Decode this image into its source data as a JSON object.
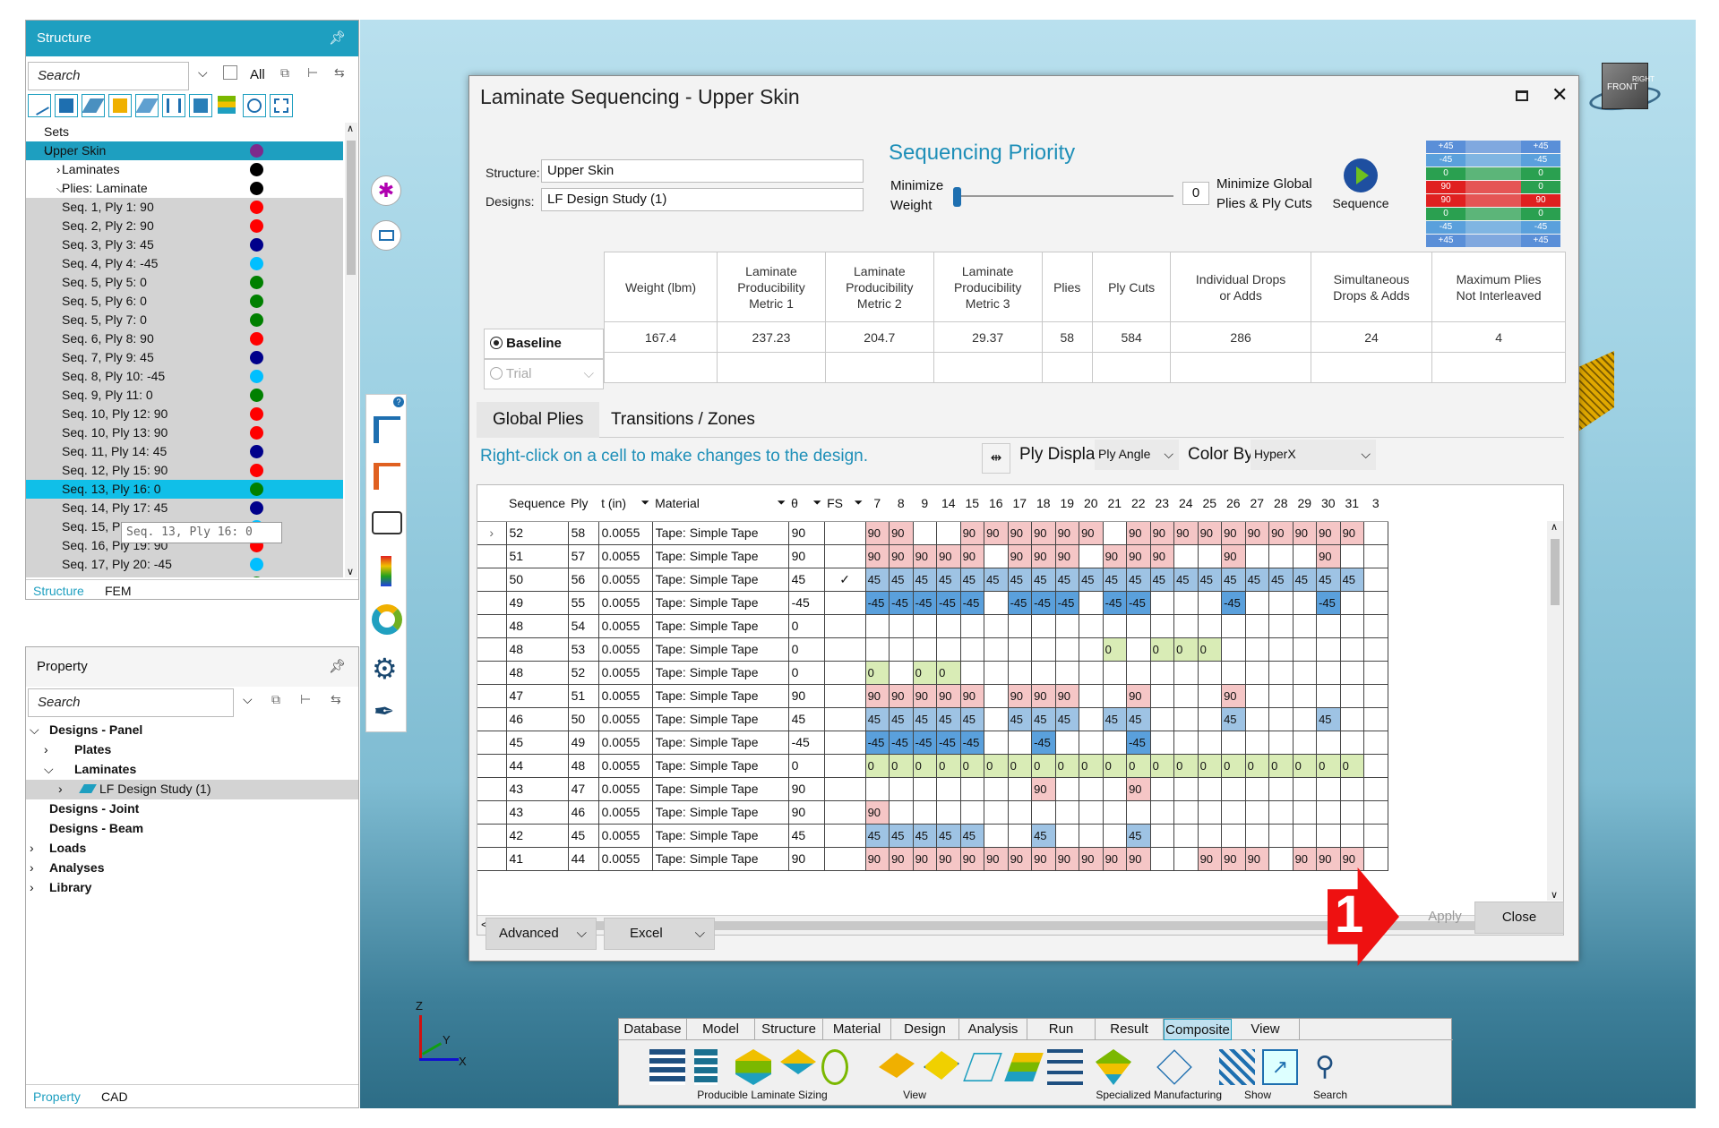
{
  "structure_panel": {
    "title": "Structure",
    "search_placeholder": "Search",
    "all_label": "All",
    "tree": [
      {
        "label": "Sets",
        "indent": 0,
        "color": ""
      },
      {
        "label": "Upper Skin",
        "indent": 1,
        "color": "#7d2a8c",
        "selected": true
      },
      {
        "label": "Laminates",
        "indent": 2,
        "color": "#000000"
      },
      {
        "label": "Plies: Laminate",
        "indent": 2,
        "color": "#000000"
      },
      {
        "label": "Seq. 1, Ply 1: 90",
        "indent": 3,
        "color": "#ff0000"
      },
      {
        "label": "Seq. 2, Ply 2: 90",
        "indent": 3,
        "color": "#ff0000"
      },
      {
        "label": "Seq. 3, Ply 3: 45",
        "indent": 3,
        "color": "#00008b"
      },
      {
        "label": "Seq. 4, Ply 4: -45",
        "indent": 3,
        "color": "#00bfff"
      },
      {
        "label": "Seq. 5, Ply 5: 0",
        "indent": 3,
        "color": "#008000"
      },
      {
        "label": "Seq. 5, Ply 6: 0",
        "indent": 3,
        "color": "#008000"
      },
      {
        "label": "Seq. 5, Ply 7: 0",
        "indent": 3,
        "color": "#008000"
      },
      {
        "label": "Seq. 6, Ply 8: 90",
        "indent": 3,
        "color": "#ff0000"
      },
      {
        "label": "Seq. 7, Ply 9: 45",
        "indent": 3,
        "color": "#00008b"
      },
      {
        "label": "Seq. 8, Ply 10: -45",
        "indent": 3,
        "color": "#00bfff"
      },
      {
        "label": "Seq. 9, Ply 11: 0",
        "indent": 3,
        "color": "#008000"
      },
      {
        "label": "Seq. 10, Ply 12: 90",
        "indent": 3,
        "color": "#ff0000"
      },
      {
        "label": "Seq. 10, Ply 13: 90",
        "indent": 3,
        "color": "#ff0000"
      },
      {
        "label": "Seq. 11, Ply 14: 45",
        "indent": 3,
        "color": "#00008b"
      },
      {
        "label": "Seq. 12, Ply 15: 90",
        "indent": 3,
        "color": "#ff0000"
      },
      {
        "label": "Seq. 13, Ply 16: 0",
        "indent": 3,
        "color": "#008000",
        "highlight": true
      },
      {
        "label": "Seq. 14, Ply 17: 45",
        "indent": 3,
        "color": "#00008b"
      },
      {
        "label": "Seq. 15, Ply 18: -45",
        "indent": 3,
        "color": "#00bfff"
      },
      {
        "label": "Seq. 16, Ply 19: 90",
        "indent": 3,
        "color": "#ff0000"
      },
      {
        "label": "Seq. 17, Ply 20: -45",
        "indent": 3,
        "color": "#00bfff"
      },
      {
        "label": "Seq. 18, Ply 21: 0",
        "indent": 3,
        "color": "#008000"
      }
    ],
    "tooltip": "Seq. 13, Ply 16: 0",
    "tabs": [
      "Structure",
      "FEM"
    ]
  },
  "property_panel": {
    "title": "Property",
    "search_placeholder": "Search",
    "tree": [
      {
        "label": "Designs - Panel",
        "indent": 0,
        "expander": "v"
      },
      {
        "label": "Plates",
        "indent": 1,
        "expander": ">"
      },
      {
        "label": "Laminates",
        "indent": 1,
        "expander": "v"
      },
      {
        "label": "LF Design Study (1)",
        "indent": 2,
        "expander": ">",
        "selected": true
      },
      {
        "label": "Designs - Joint",
        "indent": 0,
        "expander": ""
      },
      {
        "label": "Designs - Beam",
        "indent": 0,
        "expander": ""
      },
      {
        "label": "Loads",
        "indent": 0,
        "expander": ">"
      },
      {
        "label": "Analyses",
        "indent": 0,
        "expander": ">"
      },
      {
        "label": "Library",
        "indent": 0,
        "expander": ">"
      }
    ],
    "tabs": [
      "Property",
      "CAD"
    ]
  },
  "dialog": {
    "title": "Laminate Sequencing - Upper Skin",
    "structure_label": "Structure:",
    "structure_value": "Upper Skin",
    "designs_label": "Designs:",
    "designs_value": "LF Design Study (1)",
    "priority_title": "Sequencing Priority",
    "minimize_weight": [
      "Minimize",
      "Weight"
    ],
    "slider_value": "0",
    "minimize_global": [
      "Minimize Global",
      "Plies & Ply Cuts"
    ],
    "sequence_label": "Sequence",
    "preview_labels": [
      "+45",
      "-45",
      "0",
      "90",
      "90",
      "0",
      "-45",
      "+45"
    ],
    "preview_labels_right": [
      "+45",
      "-45",
      "0",
      "0",
      "90",
      "0",
      "-45",
      "+45"
    ],
    "metrics_headers": [
      [
        "Weight (lbm)"
      ],
      [
        "Laminate",
        "Producibility",
        "Metric 1"
      ],
      [
        "Laminate",
        "Producibility",
        "Metric 2"
      ],
      [
        "Laminate",
        "Producibility",
        "Metric 3"
      ],
      [
        "Plies"
      ],
      [
        "Ply Cuts"
      ],
      [
        "Individual Drops",
        "or Adds"
      ],
      [
        "Simultaneous",
        "Drops & Adds"
      ],
      [
        "Maximum Plies",
        "Not Interleaved"
      ]
    ],
    "baseline_label": "Baseline",
    "baseline_values": [
      "167.4",
      "237.23",
      "204.7",
      "29.37",
      "58",
      "584",
      "286",
      "24",
      "4"
    ],
    "trial_label": "Trial",
    "tabs": [
      "Global Plies",
      "Transitions / Zones"
    ],
    "hint": "Right-click on a cell to make changes to the design.",
    "ply_display_label": "Ply Display",
    "ply_display_value": "Ply Angle",
    "color_by_label": "Color By",
    "color_by_value": "HyperX",
    "grid_headers": [
      "Sequence",
      "Ply",
      "t (in)",
      "Material",
      "θ",
      "FS"
    ],
    "zone_headers": [
      "7",
      "8",
      "9",
      "14",
      "15",
      "16",
      "17",
      "18",
      "19",
      "20",
      "21",
      "22",
      "23",
      "24",
      "25",
      "26",
      "27",
      "28",
      "29",
      "30",
      "31",
      "3"
    ],
    "rows": [
      {
        "seq": "52",
        "ply": "58",
        "t": "0.0055",
        "mat": "Tape: Simple Tape",
        "th": "90",
        "fs": "",
        "cells": [
          "90",
          "90",
          "",
          "",
          "90",
          "90",
          "90",
          "90",
          "90",
          "90",
          "",
          "90",
          "90",
          "90",
          "90",
          "90",
          "90",
          "90",
          "90",
          "90",
          "90",
          ""
        ]
      },
      {
        "seq": "51",
        "ply": "57",
        "t": "0.0055",
        "mat": "Tape: Simple Tape",
        "th": "90",
        "fs": "",
        "cells": [
          "90",
          "90",
          "90",
          "90",
          "90",
          "",
          "90",
          "90",
          "90",
          "",
          "90",
          "90",
          "90",
          "",
          "",
          "90",
          "",
          "",
          "",
          "90",
          "",
          ""
        ]
      },
      {
        "seq": "50",
        "ply": "56",
        "t": "0.0055",
        "mat": "Tape: Simple Tape",
        "th": "45",
        "fs": "✓",
        "cells": [
          "45",
          "45",
          "45",
          "45",
          "45",
          "45",
          "45",
          "45",
          "45",
          "45",
          "45",
          "45",
          "45",
          "45",
          "45",
          "45",
          "45",
          "45",
          "45",
          "45",
          "45",
          ""
        ]
      },
      {
        "seq": "49",
        "ply": "55",
        "t": "0.0055",
        "mat": "Tape: Simple Tape",
        "th": "-45",
        "fs": "",
        "cells": [
          "-45",
          "-45",
          "-45",
          "-45",
          "-45",
          "",
          "-45",
          "-45",
          "-45",
          "",
          "-45",
          "-45",
          "",
          "",
          "",
          "-45",
          "",
          "",
          "",
          "-45",
          "",
          ""
        ]
      },
      {
        "seq": "48",
        "ply": "54",
        "t": "0.0055",
        "mat": "Tape: Simple Tape",
        "th": "0",
        "fs": "",
        "cells": [
          "",
          "",
          "",
          "",
          "",
          "",
          "",
          "",
          "",
          "",
          "",
          "",
          "",
          "",
          "",
          "",
          "",
          "",
          "",
          "",
          "",
          ""
        ]
      },
      {
        "seq": "48",
        "ply": "53",
        "t": "0.0055",
        "mat": "Tape: Simple Tape",
        "th": "0",
        "fs": "",
        "cells": [
          "",
          "",
          "",
          "",
          "",
          "",
          "",
          "",
          "",
          "",
          "0",
          "",
          "0",
          "0",
          "0",
          "",
          "",
          "",
          "",
          "",
          "",
          ""
        ]
      },
      {
        "seq": "48",
        "ply": "52",
        "t": "0.0055",
        "mat": "Tape: Simple Tape",
        "th": "0",
        "fs": "",
        "cells": [
          "0",
          "",
          "0",
          "0",
          "",
          "",
          "",
          "",
          "",
          "",
          "",
          "",
          "",
          "",
          "",
          "",
          "",
          "",
          "",
          "",
          "",
          ""
        ]
      },
      {
        "seq": "47",
        "ply": "51",
        "t": "0.0055",
        "mat": "Tape: Simple Tape",
        "th": "90",
        "fs": "",
        "cells": [
          "90",
          "90",
          "90",
          "90",
          "90",
          "",
          "90",
          "90",
          "90",
          "",
          "",
          "90",
          "",
          "",
          "",
          "90",
          "",
          "",
          "",
          "",
          "",
          ""
        ]
      },
      {
        "seq": "46",
        "ply": "50",
        "t": "0.0055",
        "mat": "Tape: Simple Tape",
        "th": "45",
        "fs": "",
        "cells": [
          "45",
          "45",
          "45",
          "45",
          "45",
          "",
          "45",
          "45",
          "45",
          "",
          "45",
          "45",
          "",
          "",
          "",
          "45",
          "",
          "",
          "",
          "45",
          "",
          ""
        ]
      },
      {
        "seq": "45",
        "ply": "49",
        "t": "0.0055",
        "mat": "Tape: Simple Tape",
        "th": "-45",
        "fs": "",
        "cells": [
          "-45",
          "-45",
          "-45",
          "-45",
          "-45",
          "",
          "",
          "-45",
          "",
          "",
          "",
          "-45",
          "",
          "",
          "",
          "",
          "",
          "",
          "",
          "",
          "",
          ""
        ]
      },
      {
        "seq": "44",
        "ply": "48",
        "t": "0.0055",
        "mat": "Tape: Simple Tape",
        "th": "0",
        "fs": "",
        "cells": [
          "0",
          "0",
          "0",
          "0",
          "0",
          "0",
          "0",
          "0",
          "0",
          "0",
          "0",
          "0",
          "0",
          "0",
          "0",
          "0",
          "0",
          "0",
          "0",
          "0",
          "0",
          ""
        ]
      },
      {
        "seq": "43",
        "ply": "47",
        "t": "0.0055",
        "mat": "Tape: Simple Tape",
        "th": "90",
        "fs": "",
        "cells": [
          "",
          "",
          "",
          "",
          "",
          "",
          "",
          "90",
          "",
          "",
          "",
          "90",
          "",
          "",
          "",
          "",
          "",
          "",
          "",
          "",
          "",
          ""
        ]
      },
      {
        "seq": "43",
        "ply": "46",
        "t": "0.0055",
        "mat": "Tape: Simple Tape",
        "th": "90",
        "fs": "",
        "cells": [
          "90",
          "",
          "",
          "",
          "",
          "",
          "",
          "",
          "",
          "",
          "",
          "",
          "",
          "",
          "",
          "",
          "",
          "",
          "",
          "",
          "",
          ""
        ]
      },
      {
        "seq": "42",
        "ply": "45",
        "t": "0.0055",
        "mat": "Tape: Simple Tape",
        "th": "45",
        "fs": "",
        "cells": [
          "45",
          "45",
          "45",
          "45",
          "45",
          "",
          "",
          "45",
          "",
          "",
          "",
          "45",
          "",
          "",
          "",
          "",
          "",
          "",
          "",
          "",
          "",
          ""
        ]
      },
      {
        "seq": "41",
        "ply": "44",
        "t": "0.0055",
        "mat": "Tape: Simple Tape",
        "th": "90",
        "fs": "",
        "cells": [
          "90",
          "90",
          "90",
          "90",
          "90",
          "90",
          "90",
          "90",
          "90",
          "90",
          "90",
          "90",
          "",
          "",
          "90",
          "90",
          "90",
          "",
          "90",
          "90",
          "90",
          ""
        ]
      }
    ],
    "advanced_label": "Advanced",
    "excel_label": "Excel",
    "apply_label": "Apply",
    "close_label": "Close",
    "callout_number": "1"
  },
  "ribbon": {
    "tabs": [
      "Database",
      "Model",
      "Structure",
      "Material",
      "Design",
      "Analysis",
      "Run",
      "Result",
      "Composite",
      "View"
    ],
    "active_tab": "Composite",
    "groups": [
      "Producible Laminate Sizing",
      "View",
      "Specialized",
      "Manufacturing",
      "Show",
      "Search"
    ]
  },
  "nav_cube": {
    "front": "FRONT",
    "right": "RIGHT"
  },
  "axes": {
    "z": "Z",
    "y": "Y",
    "x": "X"
  },
  "colors": {
    "accent": "#1e9fc0",
    "c90": "#f5c6c6",
    "c45": "#9ec3e4",
    "cm45": "#5aa0dc",
    "c0": "#d9ecb6",
    "callout": "#ee1111"
  }
}
